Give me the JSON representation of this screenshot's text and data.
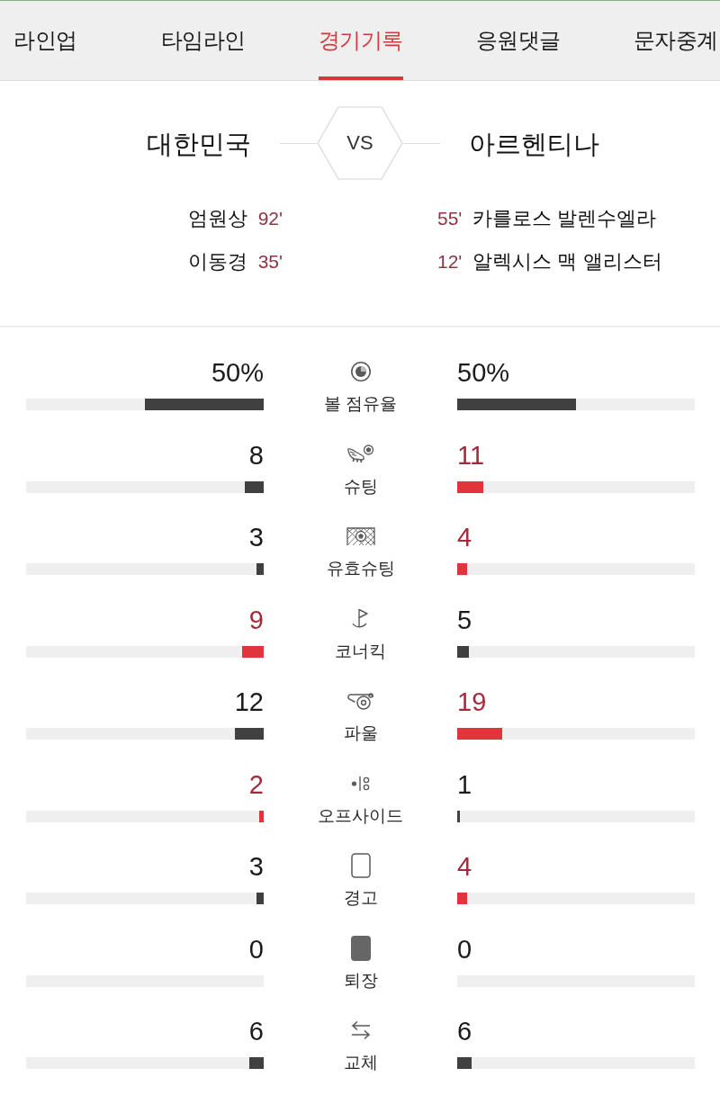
{
  "tabs": [
    {
      "label": "라인업",
      "selected": false
    },
    {
      "label": "타임라인",
      "selected": false
    },
    {
      "label": "경기기록",
      "selected": true
    },
    {
      "label": "응원댓글",
      "selected": false
    },
    {
      "label": "문자중계",
      "selected": false
    }
  ],
  "match": {
    "home": {
      "name": "대한민국",
      "scorers": [
        {
          "name": "엄원상",
          "minute": "92'"
        },
        {
          "name": "이동경",
          "minute": "35'"
        }
      ]
    },
    "vs": "VS",
    "away": {
      "name": "아르헨티나",
      "scorers": [
        {
          "minute": "55'",
          "name": "카를로스 발렌수엘라"
        },
        {
          "minute": "12'",
          "name": "알렉시스 맥 앨리스터"
        }
      ]
    }
  },
  "stats": [
    {
      "kind": "possession",
      "label": "볼 점유율",
      "home": {
        "value": "50%",
        "level": 0.5,
        "leading": false
      },
      "away": {
        "value": "50%",
        "level": 0.5,
        "leading": false
      }
    },
    {
      "kind": "shots",
      "label": "슈팅",
      "home": {
        "value": "8",
        "level": 0.08,
        "leading": false
      },
      "away": {
        "value": "11",
        "level": 0.11,
        "leading": true
      }
    },
    {
      "kind": "shots_on_target",
      "label": "유효슈팅",
      "home": {
        "value": "3",
        "level": 0.03,
        "leading": false
      },
      "away": {
        "value": "4",
        "level": 0.04,
        "leading": true
      }
    },
    {
      "kind": "corners",
      "label": "코너킥",
      "home": {
        "value": "9",
        "level": 0.09,
        "leading": true
      },
      "away": {
        "value": "5",
        "level": 0.05,
        "leading": false
      }
    },
    {
      "kind": "fouls",
      "label": "파울",
      "home": {
        "value": "12",
        "level": 0.12,
        "leading": false
      },
      "away": {
        "value": "19",
        "level": 0.19,
        "leading": true
      }
    },
    {
      "kind": "offsides",
      "label": "오프사이드",
      "home": {
        "value": "2",
        "level": 0.02,
        "leading": true
      },
      "away": {
        "value": "1",
        "level": 0.01,
        "leading": false
      }
    },
    {
      "kind": "yellow_cards",
      "label": "경고",
      "home": {
        "value": "3",
        "level": 0.03,
        "leading": false
      },
      "away": {
        "value": "4",
        "level": 0.04,
        "leading": true
      }
    },
    {
      "kind": "red_cards",
      "label": "퇴장",
      "home": {
        "value": "0",
        "leading": false
      },
      "away": {
        "value": "0",
        "leading": false
      }
    },
    {
      "kind": "substitutions",
      "label": "교체",
      "home": {
        "value": "6",
        "level": 0.06,
        "leading": false
      },
      "away": {
        "value": "6",
        "level": 0.06,
        "leading": false
      }
    }
  ]
}
